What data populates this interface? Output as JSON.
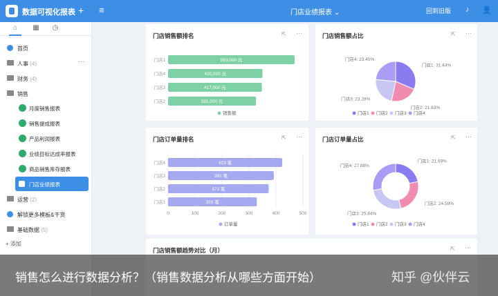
{
  "topbar": {
    "app_title": "数据可视化报表",
    "plus": "+",
    "menu": "≡",
    "center_title": "门店业绩报表 ⌄",
    "back_label": "回到旧版",
    "bell": "♪",
    "user": "👤"
  },
  "sidebar": {
    "tabs": [
      "⌂",
      "▦",
      "◷"
    ],
    "items": [
      {
        "label": "首页",
        "count": ""
      },
      {
        "label": "人事",
        "count": "(4)"
      },
      {
        "label": "财务",
        "count": "(4)"
      },
      {
        "label": "销售",
        "count": ""
      }
    ],
    "sub_items": [
      "月度销售报表",
      "销售提成报表",
      "产品利润报表",
      "业绩目标达成率报表",
      "商品销售库存报表",
      "门店业绩报表"
    ],
    "bottom_items": [
      {
        "label": "运营",
        "count": "(2)"
      },
      {
        "label": "解锁更多模板&干货",
        "count": ""
      },
      {
        "label": "基础数据",
        "count": "(5)"
      }
    ],
    "more": "···",
    "add": "+ 添加"
  },
  "cards": {
    "sales_rank": {
      "title": "门店销售额排名"
    },
    "sales_share": {
      "title": "门店销售额占比"
    },
    "orders_rank": {
      "title": "门店订单量排名"
    },
    "orders_share": {
      "title": "门店订单量占比"
    },
    "trend": {
      "title": "门店销售额趋势对比（月）"
    },
    "ext": "⇱",
    "more": "···"
  },
  "chart_data": [
    {
      "type": "bar",
      "orientation": "horizontal",
      "categories": [
        "门店1",
        "门店4",
        "门店3",
        "门店2"
      ],
      "values": [
        563000,
        420000,
        417000,
        391000
      ],
      "data_labels": [
        "563,000 元",
        "420,000 元",
        "417,000 元",
        "391,000 元"
      ],
      "series": [
        {
          "name": "销售额",
          "color": "#7ed0a5"
        }
      ]
    },
    {
      "type": "pie",
      "labels": [
        "门店1",
        "门店2",
        "门店3",
        "门店4"
      ],
      "values": [
        31.44,
        21.83,
        23.28,
        23.45
      ],
      "data_labels": [
        "门店1: 31.44%",
        "门店2: 21.83%",
        "门店3: 23.28%",
        "门店4: 23.45%"
      ],
      "colors": [
        "#8a7bf0",
        "#f08cb0",
        "#c8c6f2",
        "#a89cf5"
      ],
      "legend": "bottom"
    },
    {
      "type": "bar",
      "orientation": "horizontal",
      "categories": [
        "门店4",
        "门店3",
        "门店2",
        "门店1"
      ],
      "values": [
        423,
        392,
        373,
        329
      ],
      "data_labels": [
        "423 笔",
        "392 笔",
        "373 笔",
        "329 笔"
      ],
      "xticks": [
        "0",
        "100",
        "200",
        "300",
        "400",
        "500"
      ],
      "xlim": [
        0,
        500
      ],
      "series": [
        {
          "name": "订单量",
          "color": "#a5a9f0"
        }
      ]
    },
    {
      "type": "pie",
      "donut": true,
      "labels": [
        "门店1",
        "门店2",
        "门店3",
        "门店4"
      ],
      "values": [
        21.69,
        24.59,
        25.84,
        27.88
      ],
      "data_labels": [
        "门店1: 21.69%",
        "门店2: 24.59%",
        "门店3: 25.84%",
        "门店4: 27.88%"
      ],
      "colors": [
        "#8a7bf0",
        "#f08cb0",
        "#c8c6f2",
        "#a89cf5"
      ],
      "legend": "bottom"
    }
  ],
  "overlay": {
    "caption": "销售怎么进行数据分析？（销售数据分析从哪些方面开始）",
    "watermark": "知乎 @伙伴云"
  }
}
